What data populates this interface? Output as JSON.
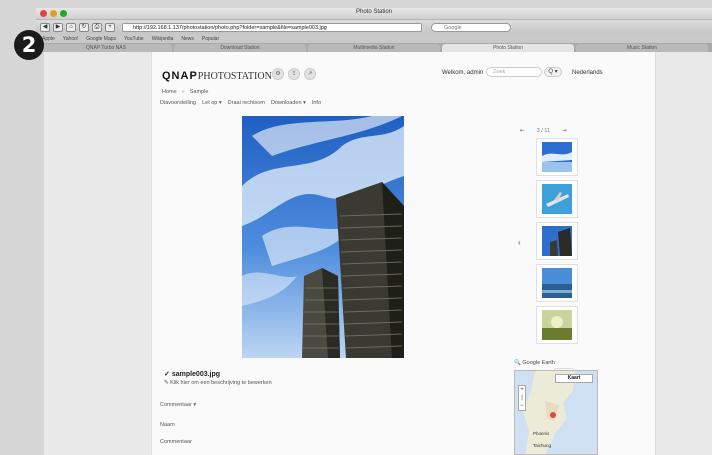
{
  "step_number": "2",
  "browser": {
    "window_title": "Photo Station",
    "url": "http://192.168.1.137/photostation/photo.php?folder=sample&file=sample003.jpg",
    "search_placeholder": "Google",
    "bookmarks": [
      "Apple",
      "Yahoo!",
      "Google Maps",
      "YouTube",
      "Wikipedia",
      "News",
      "Popular"
    ],
    "tabs": [
      {
        "label": "QNAP Turbo NAS",
        "active": false
      },
      {
        "label": "Download Station",
        "active": false
      },
      {
        "label": "Multimedia Station",
        "active": false
      },
      {
        "label": "Photo Station",
        "active": true
      },
      {
        "label": "Music Station",
        "active": false
      }
    ]
  },
  "header": {
    "logo_brand": "QNAP",
    "logo_product": "PHOTOSTATION",
    "welcome": "Welkom, admin",
    "search_placeholder": "Zoek",
    "search_button": "Q ▾",
    "language": "Nederlands"
  },
  "breadcrumb": [
    "Home",
    "Sample"
  ],
  "actions": [
    "Diavoorstelling",
    "Let op ▾",
    "Draai rechtsom",
    "Downloaden ▾",
    "Info"
  ],
  "photo": {
    "filename": "sample003.jpg",
    "description": "Klik hier om een beschrijving te bewerken",
    "comments_label": "Commentaar ▾",
    "name_label": "Naam",
    "comment_label": "Commentaar"
  },
  "thumbnails": {
    "counter_current": "3 / 11",
    "items": [
      "sky-thumb-1",
      "plane-thumb-2",
      "building-thumb-3",
      "sea-thumb-4",
      "field-thumb-5"
    ]
  },
  "map": {
    "label": "Google Earth",
    "type_selector": "Kaart",
    "cities": [
      "Phoenix",
      "Taichung"
    ]
  }
}
